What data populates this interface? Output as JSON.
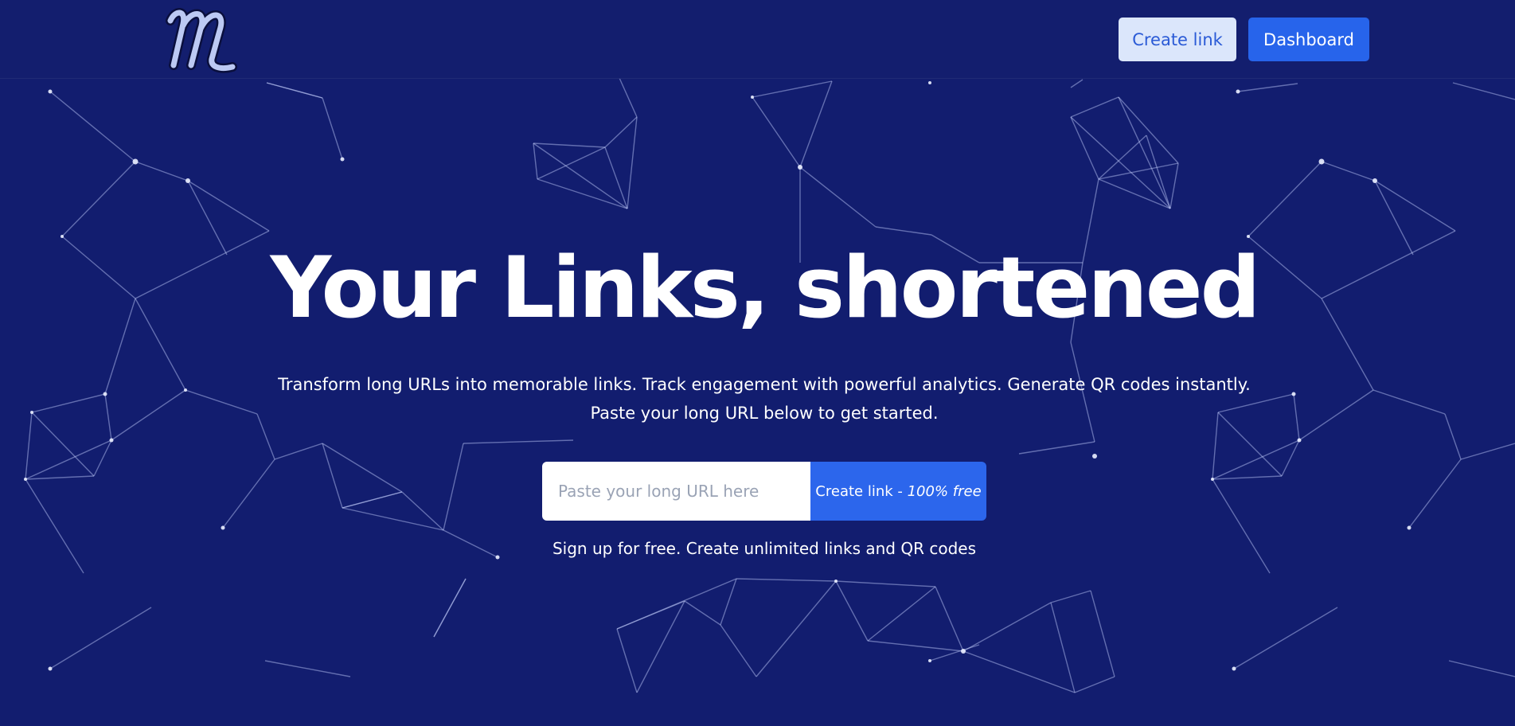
{
  "header": {
    "logo_icon": "script-m-logo-icon",
    "create_link_label": "Create link",
    "dashboard_label": "Dashboard"
  },
  "hero": {
    "title": "Your Links, shortened",
    "subtitle_line1": "Transform long URLs into memorable links. Track engagement with powerful analytics. Generate QR codes instantly.",
    "subtitle_line2": "Paste your long URL below to get started."
  },
  "form": {
    "url_placeholder": "Paste your long URL here",
    "url_value": "",
    "submit_label": "Create link - ",
    "submit_emphasis": "100% free"
  },
  "signup_note": "Sign up for free. Create unlimited links and QR codes",
  "colors": {
    "background": "#121d6f",
    "header": "#141e6e",
    "primary": "#2764eb",
    "secondary_button": "#dbe6fb",
    "text": "#ffffff"
  }
}
